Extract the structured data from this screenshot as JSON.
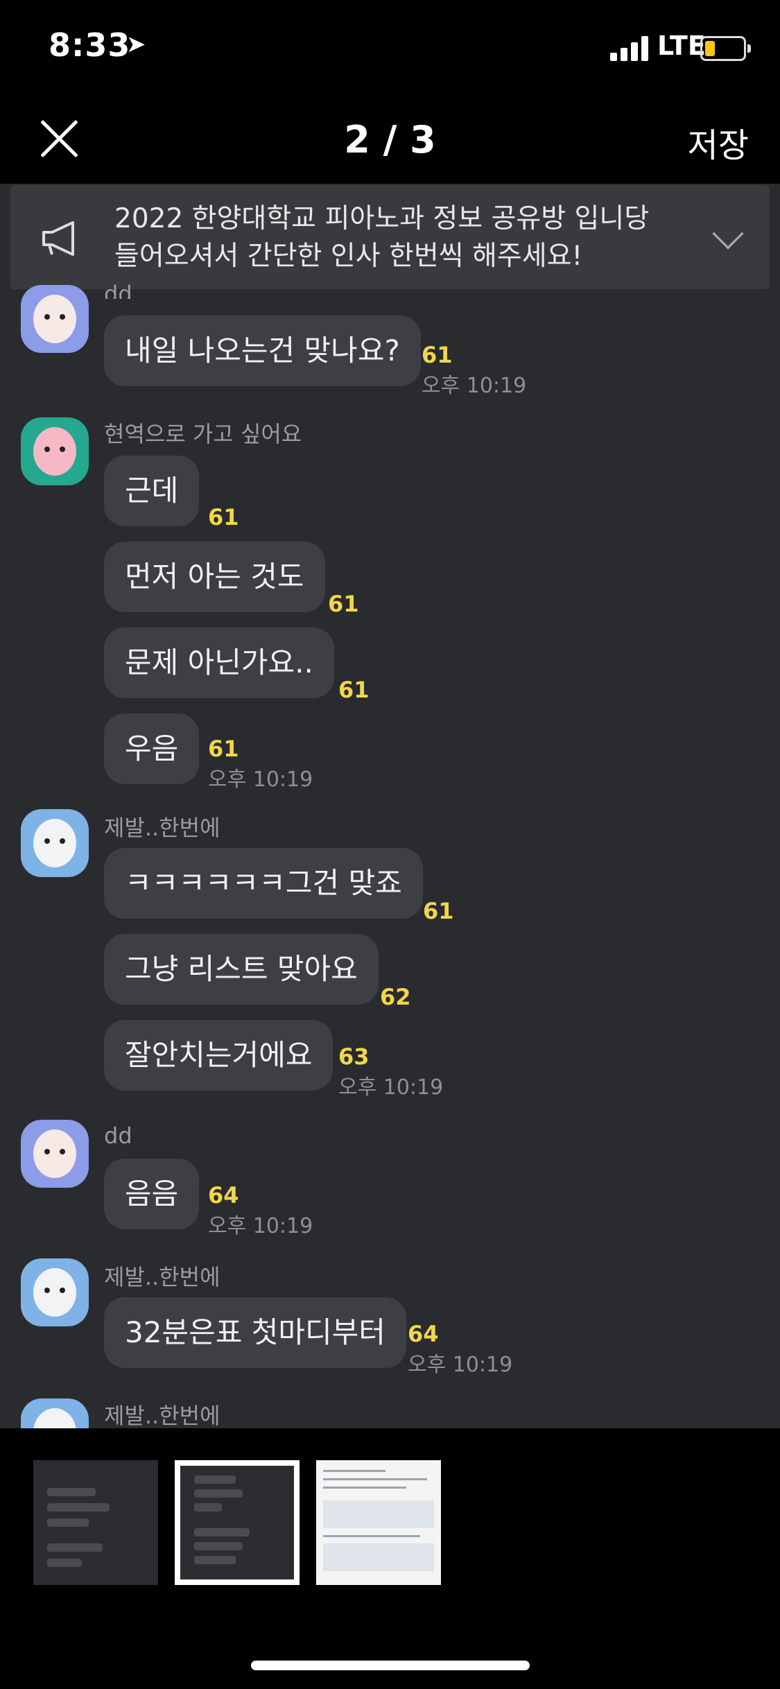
{
  "status": {
    "time": "8:33",
    "network": "LTE"
  },
  "nav": {
    "counter": "2 / 3",
    "save": "저장"
  },
  "notice": {
    "line1": "2022 한양대학교 피아노과 정보 공유방 입니당",
    "line2": "들어오셔서 간단한 인사 한번씩 해주세요!"
  },
  "messages": {
    "top_name_partial": "dd",
    "m1": {
      "text": "내일 나오는건 맞나요?",
      "count": "61",
      "time": "오후 10:19"
    },
    "g2": {
      "name": "현역으로 가고 싶어요",
      "b1": "근데",
      "c1": "61",
      "b2": "먼저 아는 것도",
      "c2": "61",
      "b3": "문제 아닌가요..",
      "c3": "61",
      "b4": "우음",
      "c4": "61",
      "time": "오후 10:19"
    },
    "g3": {
      "name": "제발..한번에",
      "b1": "ㅋㅋㅋㅋㅋㅋ그건 맞죠",
      "c1": "61",
      "b2": "그냥 리스트 맞아요",
      "c2": "62",
      "b3": "잘안치는거에요",
      "c3": "63",
      "time": "오후 10:19"
    },
    "g4": {
      "name": "dd",
      "b1": "음음",
      "c1": "64",
      "time": "오후 10:19"
    },
    "g5": {
      "name": "제발..한번에",
      "b1": "32분은표 첫마디부터",
      "c1": "64",
      "time": "오후 10:19"
    },
    "g6": {
      "name": "제발..한번에"
    }
  },
  "colors": {
    "chat_bg": "#2a2b2f",
    "bubble": "#3e3f44",
    "unread": "#f2d64b",
    "battery": "#f6c90e"
  }
}
